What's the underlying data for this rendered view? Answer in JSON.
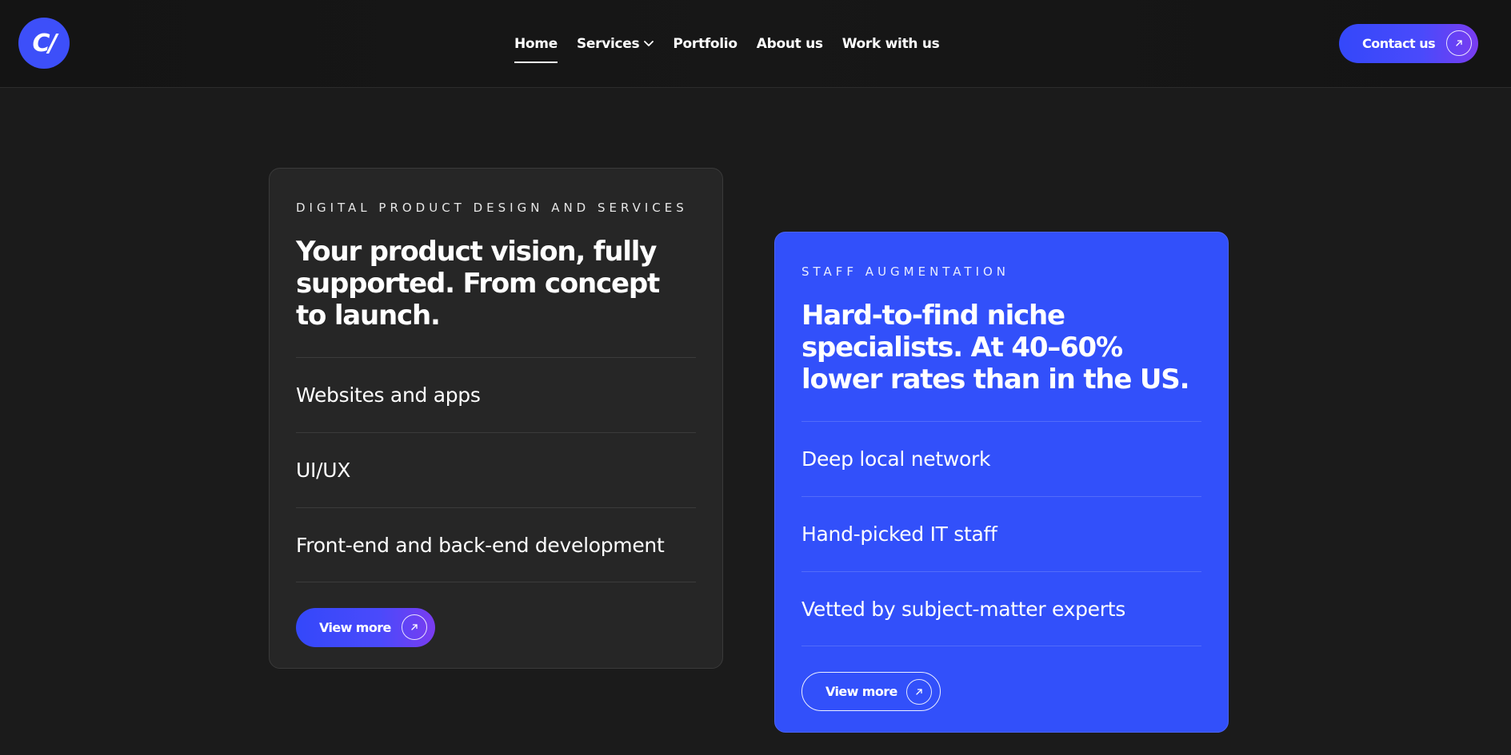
{
  "header": {
    "logo_text": "C/",
    "nav": [
      {
        "label": "Home",
        "active": true
      },
      {
        "label": "Services",
        "has_dropdown": true
      },
      {
        "label": "Portfolio"
      },
      {
        "label": "About us"
      },
      {
        "label": "Work with us"
      }
    ],
    "contact_label": "Contact us"
  },
  "cards": [
    {
      "eyebrow": "DIGITAL PRODUCT DESIGN AND SERVICES",
      "headline": "Your product vision, fully supported. From concept to launch.",
      "items": [
        "Websites and apps",
        "UI/UX",
        "Front-end and back-end development"
      ],
      "button_label": "View more"
    },
    {
      "eyebrow": "STAFF AUGMENTATION",
      "headline": "Hard-to-find niche specialists. At 40–60% lower rates than in the US.",
      "items": [
        "Deep local network",
        "Hand-picked IT staff",
        "Vetted by subject-matter experts"
      ],
      "button_label": "View more"
    }
  ],
  "colors": {
    "accent": "#3250fa",
    "background": "#1b1b1b",
    "card_dark": "#262626",
    "gradient_end": "#7a3cf0"
  },
  "icons": {
    "logo": "company-logo",
    "dropdown": "chevron-down-icon",
    "arrow": "arrow-up-right-icon"
  }
}
